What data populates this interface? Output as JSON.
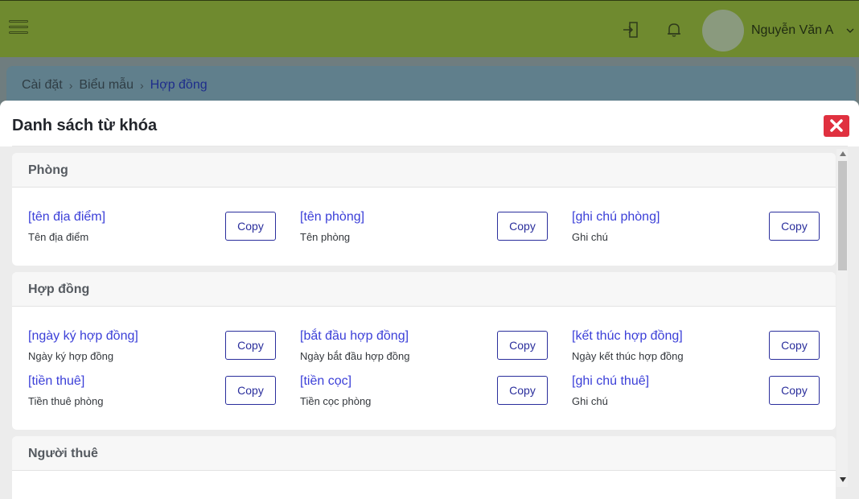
{
  "header": {
    "username": "Nguyễn Văn A",
    "icons": [
      "menu-icon",
      "door-icon",
      "bell-icon",
      "chevron-down-icon"
    ]
  },
  "breadcrumb": {
    "items": [
      "Cài đặt",
      "Biểu mẫu",
      "Hợp đồng"
    ]
  },
  "modal": {
    "title": "Danh sách từ khóa",
    "close_icon": "close-icon",
    "copy_label": "Copy",
    "sections": [
      {
        "title": "Phòng",
        "keywords": [
          {
            "name": "[tên địa điểm]",
            "desc": "Tên địa điểm"
          },
          {
            "name": "[tên phòng]",
            "desc": "Tên phòng"
          },
          {
            "name": "[ghi chú phòng]",
            "desc": "Ghi chú"
          }
        ]
      },
      {
        "title": "Hợp đồng",
        "keywords": [
          {
            "name": "[ngày ký hợp đồng]",
            "desc": "Ngày ký hợp đồng"
          },
          {
            "name": "[bắt đầu hợp đồng]",
            "desc": "Ngày bắt đầu hợp đồng"
          },
          {
            "name": "[kết thúc hợp đồng]",
            "desc": "Ngày kết thúc hợp đồng"
          },
          {
            "name": "[tiền thuê]",
            "desc": "Tiền thuê phòng"
          },
          {
            "name": "[tiền cọc]",
            "desc": "Tiền cọc phòng"
          },
          {
            "name": "[ghi chú thuê]",
            "desc": "Ghi chú"
          }
        ]
      },
      {
        "title": "Người thuê",
        "keywords": []
      }
    ]
  },
  "colors": {
    "accent": "#3b3fd8",
    "close": "#e0303f",
    "topbar": "#6f8a2f"
  }
}
